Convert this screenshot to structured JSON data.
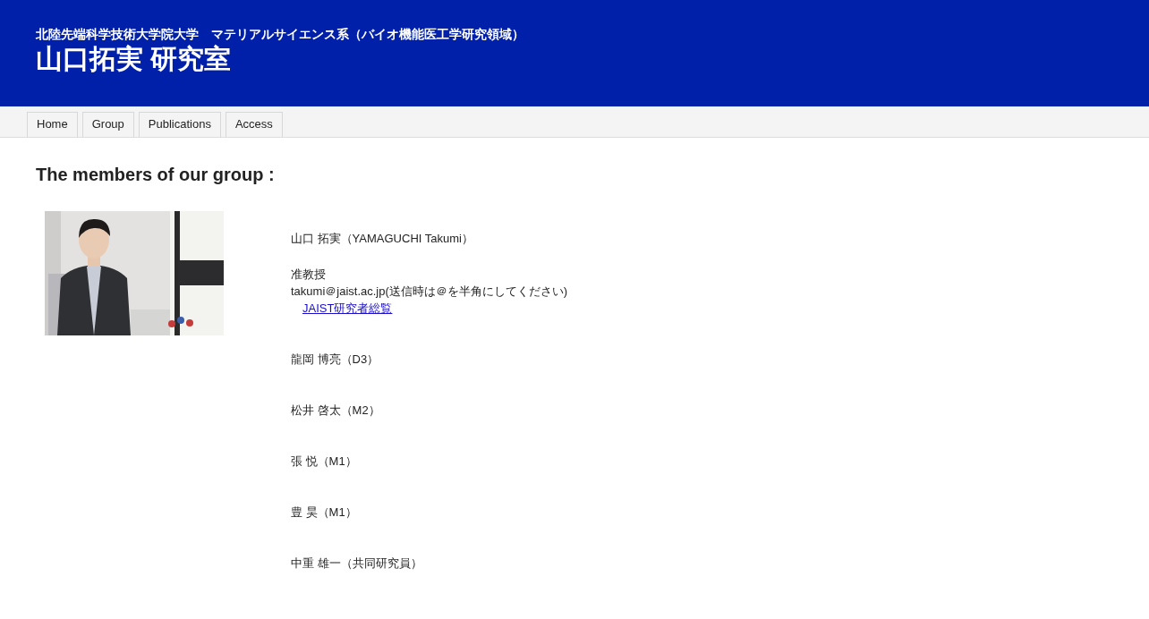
{
  "header": {
    "subtitle": "北陸先端科学技術大学院大学　マテリアルサイエンス系（バイオ機能医工学研究領域）",
    "title": "山口拓実 研究室"
  },
  "tabs": [
    {
      "label": "Home",
      "selected": false
    },
    {
      "label": "Group",
      "selected": false
    },
    {
      "label": "Publications",
      "selected": false
    },
    {
      "label": "Access",
      "selected": false
    }
  ],
  "heading": "The members of our group :",
  "leader": {
    "name": "山口 拓実（YAMAGUCHI Takumi）",
    "position": "准教授",
    "email": "takumi＠jaist.ac.jp(送信時は＠を半角にしてください)",
    "link": "JAIST研究者総覧"
  },
  "members": [
    "龍岡 博亮（D3）",
    "松井 啓太（M2）",
    "張 悦（M1）",
    "豊 昊（M1）",
    "中重 雄一（共同研究員）"
  ]
}
